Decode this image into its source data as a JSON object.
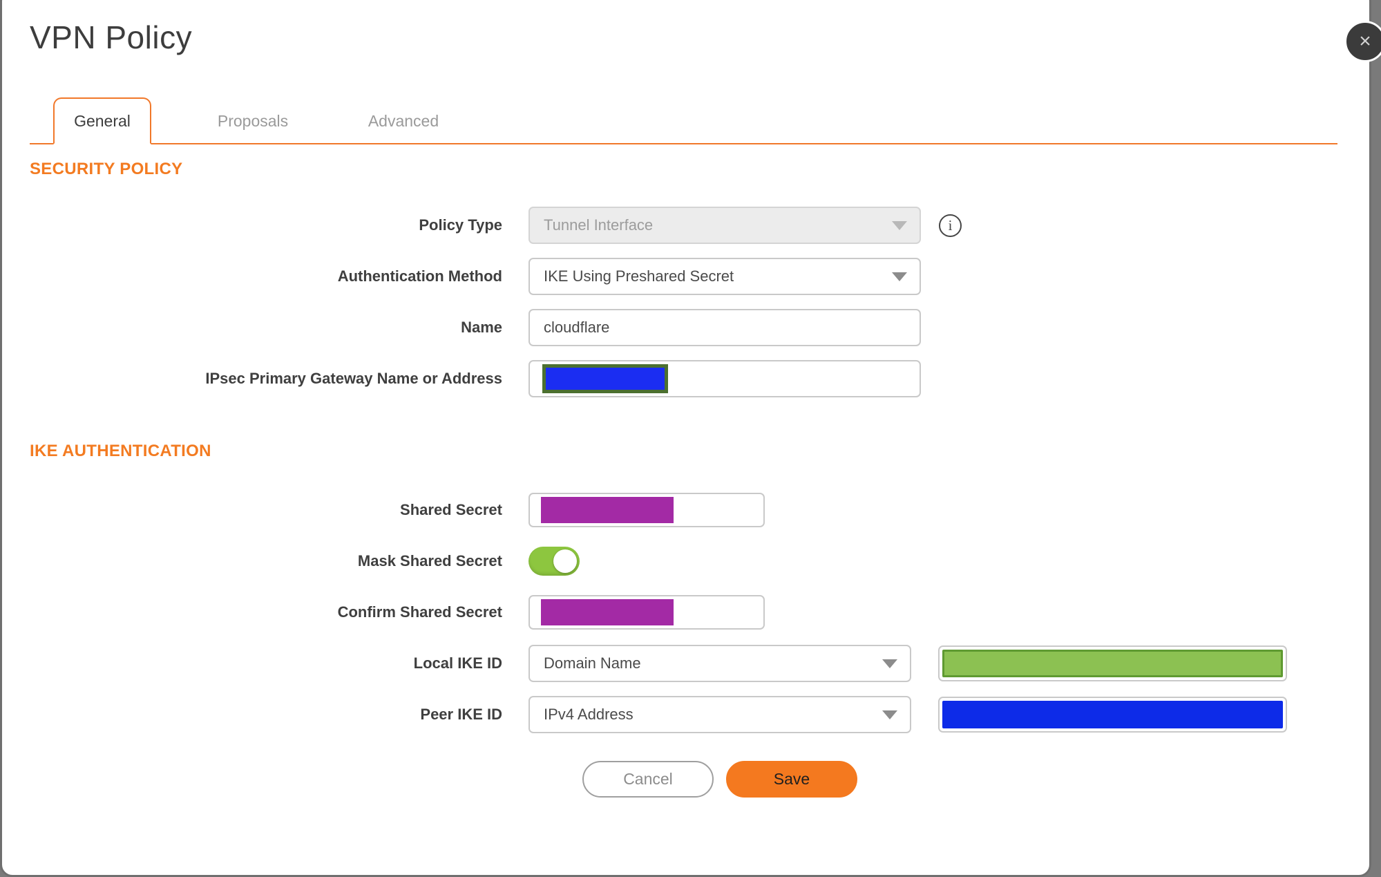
{
  "dialog": {
    "title": "VPN Policy",
    "close_icon": "×"
  },
  "tabs": [
    {
      "label": "General",
      "active": true
    },
    {
      "label": "Proposals",
      "active": false
    },
    {
      "label": "Advanced",
      "active": false
    }
  ],
  "sections": {
    "security_policy": {
      "title": "SECURITY POLICY"
    },
    "ike_authentication": {
      "title": "IKE AUTHENTICATION"
    }
  },
  "fields": {
    "policy_type": {
      "label": "Policy Type",
      "value": "Tunnel Interface",
      "disabled": true
    },
    "auth_method": {
      "label": "Authentication Method",
      "value": "IKE Using Preshared Secret"
    },
    "name": {
      "label": "Name",
      "value": "cloudflare"
    },
    "gateway": {
      "label": "IPsec Primary Gateway Name or Address",
      "value": "",
      "redacted": true
    },
    "shared_secret": {
      "label": "Shared Secret",
      "value": "",
      "redacted": true
    },
    "mask_shared_secret": {
      "label": "Mask Shared Secret",
      "on": true
    },
    "confirm_shared_secret": {
      "label": "Confirm Shared Secret",
      "value": "",
      "redacted": true
    },
    "local_ike_id": {
      "label": "Local IKE ID",
      "value": "Domain Name",
      "id_value_redacted": true
    },
    "peer_ike_id": {
      "label": "Peer IKE ID",
      "value": "IPv4 Address",
      "id_value_redacted": true
    }
  },
  "buttons": {
    "cancel": "Cancel",
    "save": "Save"
  },
  "icons": {
    "info": "i"
  },
  "colors": {
    "accent_orange": "#f1782a",
    "save_orange": "#f4791f",
    "toggle_green": "#8dc63f",
    "redaction_blue": "#1b2df2",
    "redaction_purple": "#a32aa5",
    "redaction_green_fill": "#8cc152",
    "redaction_green_border": "#5f9a31",
    "redaction_gateway_border": "#4c7030",
    "section_header_orange": "#f37b21"
  }
}
